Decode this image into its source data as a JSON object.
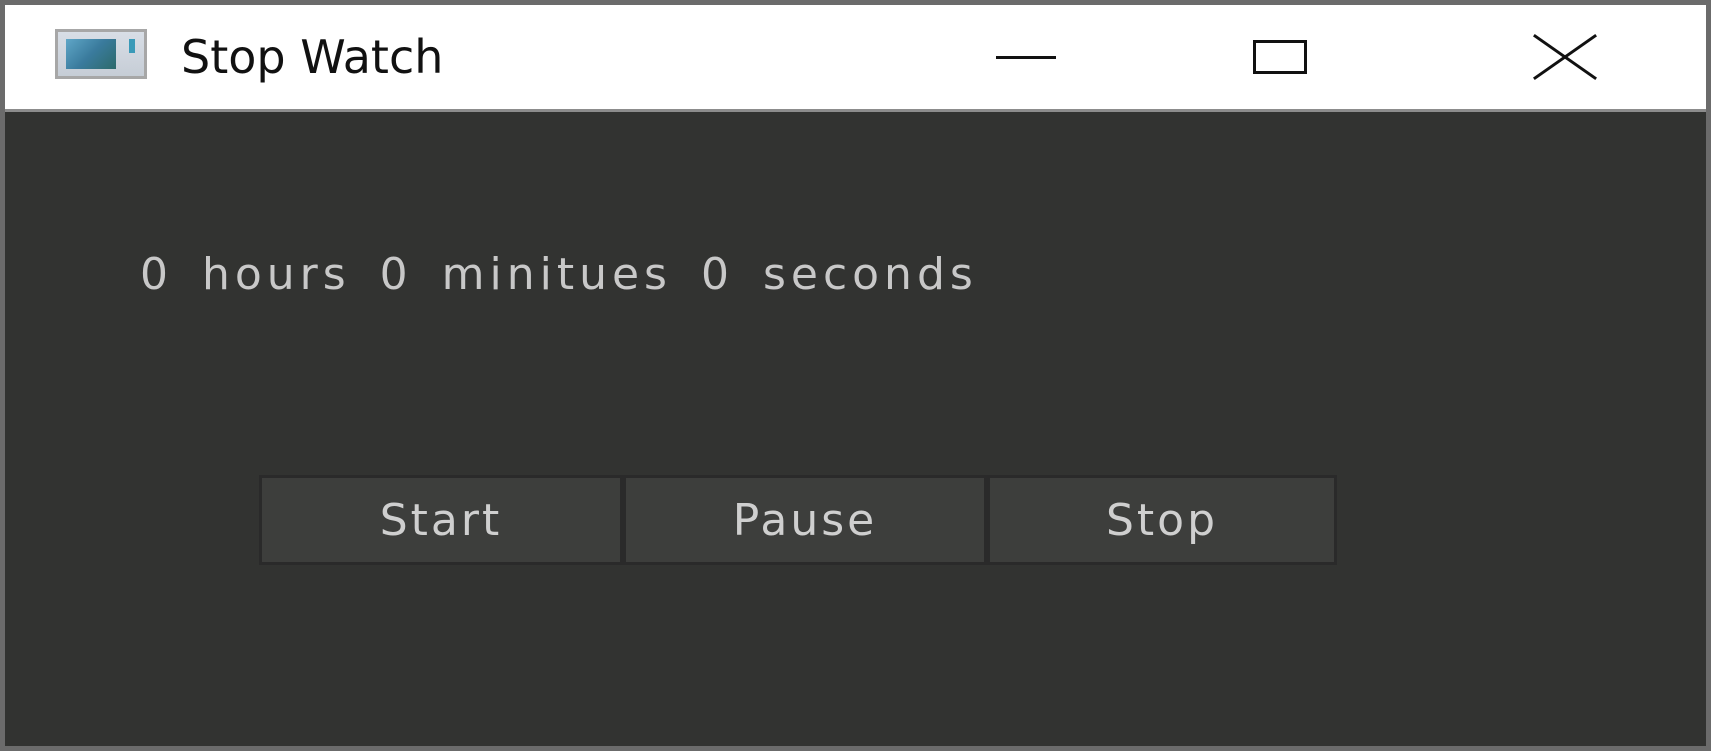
{
  "window": {
    "title": "Stop Watch",
    "icon": "app-window-icon",
    "controls": {
      "minimize_icon": "minimize-icon",
      "maximize_icon": "maximize-icon",
      "close_icon": "close-icon"
    }
  },
  "display": {
    "time_text": "0 hours 0 minitues 0 seconds"
  },
  "buttons": {
    "start": "Start",
    "pause": "Pause",
    "stop": "Stop"
  },
  "colors": {
    "background": "#323331",
    "button_background": "#3d3e3c",
    "text": "#c8c8c8",
    "titlebar": "#ffffff"
  }
}
